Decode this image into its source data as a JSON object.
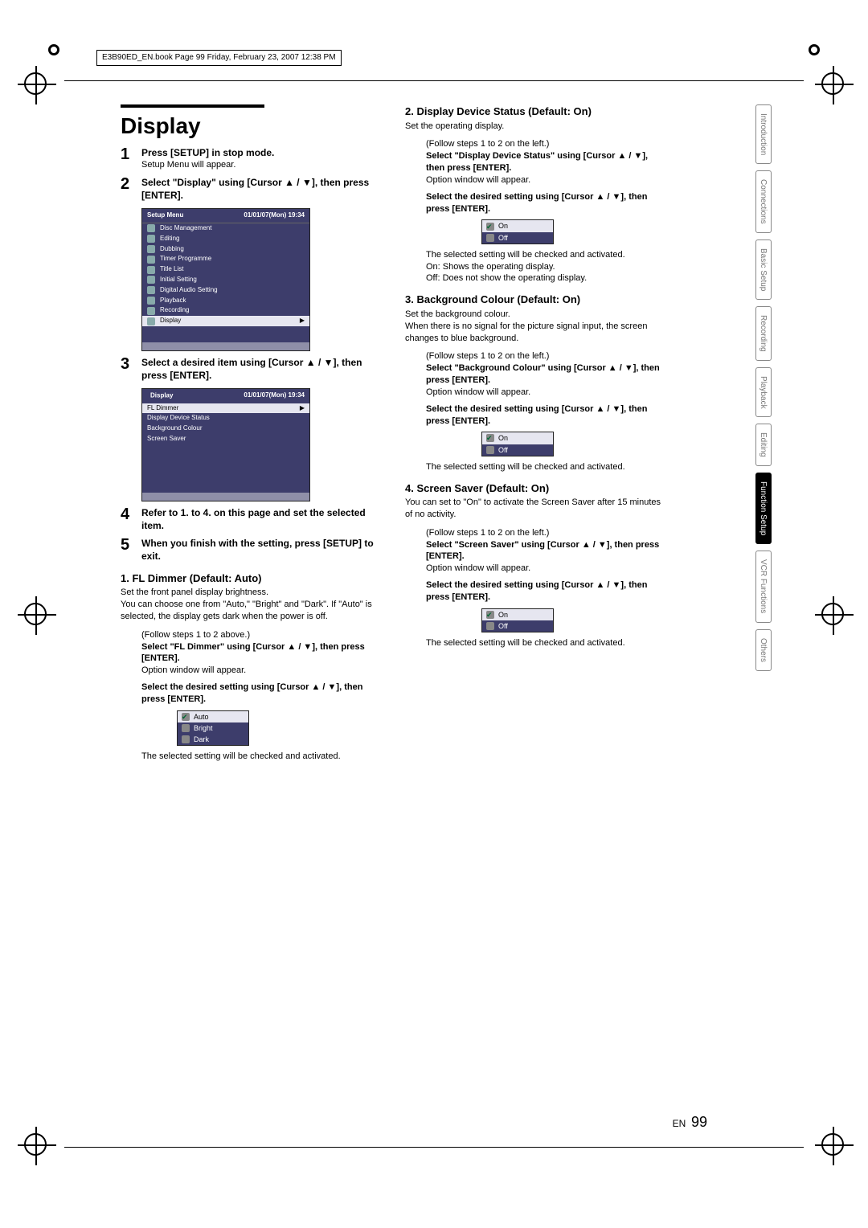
{
  "meta": {
    "bookline": "E3B90ED_EN.book  Page 99  Friday, February 23, 2007  12:38 PM"
  },
  "page": {
    "lang_code": "EN",
    "number": "99"
  },
  "left": {
    "title": "Display",
    "steps": [
      {
        "n": "1",
        "bold": "Press [SETUP] in stop mode.",
        "after": "Setup Menu will appear."
      },
      {
        "n": "2",
        "bold": "Select \"Display\" using [Cursor ▲ / ▼], then press [ENTER]."
      },
      {
        "n": "3",
        "bold": "Select a desired item using [Cursor ▲ / ▼], then press [ENTER]."
      },
      {
        "n": "4",
        "bold": "Refer to 1. to 4. on this page and set the selected item."
      },
      {
        "n": "5",
        "bold": "When you finish with the setting, press [SETUP] to exit."
      }
    ],
    "setup_menu": {
      "title": "Setup Menu",
      "datetime": "01/01/07(Mon)    19:34",
      "items": [
        "Disc Management",
        "Editing",
        "Dubbing",
        "Timer Programme",
        "Title List",
        "Initial Setting",
        "Digital Audio Setting",
        "Playback",
        "Recording",
        "Display"
      ]
    },
    "display_menu": {
      "title": "Display",
      "datetime": "01/01/07(Mon)    19:34",
      "items": [
        "FL Dimmer",
        "Display Device Status",
        "Background Colour",
        "Screen Saver"
      ]
    },
    "sec1": {
      "heading": "1. FL Dimmer (Default: Auto)",
      "p1": "Set the front panel display brightness.",
      "p2": "You can choose one from \"Auto,\" \"Bright\" and \"Dark\". If \"Auto\" is selected, the display gets dark when the power is off.",
      "follow": "(Follow steps 1 to 2 above.)",
      "b1": "Select \"FL Dimmer\" using [Cursor ▲ / ▼], then press [ENTER].",
      "opt_appear": "Option window will appear.",
      "b2": "Select the desired setting using [Cursor ▲ / ▼], then press [ENTER].",
      "options": [
        "Auto",
        "Bright",
        "Dark"
      ],
      "result": "The selected setting will be checked and activated."
    }
  },
  "right": {
    "sec2": {
      "heading": "2. Display Device Status (Default: On)",
      "p1": "Set the operating display.",
      "follow": "(Follow steps 1 to 2 on the left.)",
      "b1": "Select \"Display Device Status\" using [Cursor ▲ / ▼], then press [ENTER].",
      "opt_appear": "Option window will appear.",
      "b2": "Select the desired setting using [Cursor ▲ / ▼], then press [ENTER].",
      "options": [
        "On",
        "Off"
      ],
      "result": "The selected setting will be checked and activated.",
      "r2": "On: Shows the operating display.",
      "r3": "Off: Does not show the operating display."
    },
    "sec3": {
      "heading": "3. Background Colour (Default: On)",
      "p1": "Set the background colour.",
      "p2": "When there is no signal for the picture signal input, the screen changes to blue background.",
      "follow": "(Follow steps 1 to 2 on the left.)",
      "b1": "Select \"Background Colour\" using [Cursor ▲ / ▼], then press [ENTER].",
      "opt_appear": "Option window will appear.",
      "b2": "Select the desired setting using [Cursor ▲ / ▼], then press [ENTER].",
      "options": [
        "On",
        "Off"
      ],
      "result": "The selected setting will be checked and activated."
    },
    "sec4": {
      "heading": "4. Screen Saver (Default: On)",
      "p1": "You can set to \"On\" to activate the Screen Saver after 15 minutes of no activity.",
      "follow": "(Follow steps 1 to 2 on the left.)",
      "b1": "Select \"Screen Saver\" using [Cursor ▲ / ▼], then press [ENTER].",
      "opt_appear": "Option window will appear.",
      "b2": "Select the desired setting using [Cursor ▲ / ▼], then press [ENTER].",
      "options": [
        "On",
        "Off"
      ],
      "result": "The selected setting will be checked and activated."
    }
  },
  "tabs": [
    "Introduction",
    "Connections",
    "Basic Setup",
    "Recording",
    "Playback",
    "Editing",
    "Function Setup",
    "VCR Functions",
    "Others"
  ],
  "active_tab": "Function Setup"
}
